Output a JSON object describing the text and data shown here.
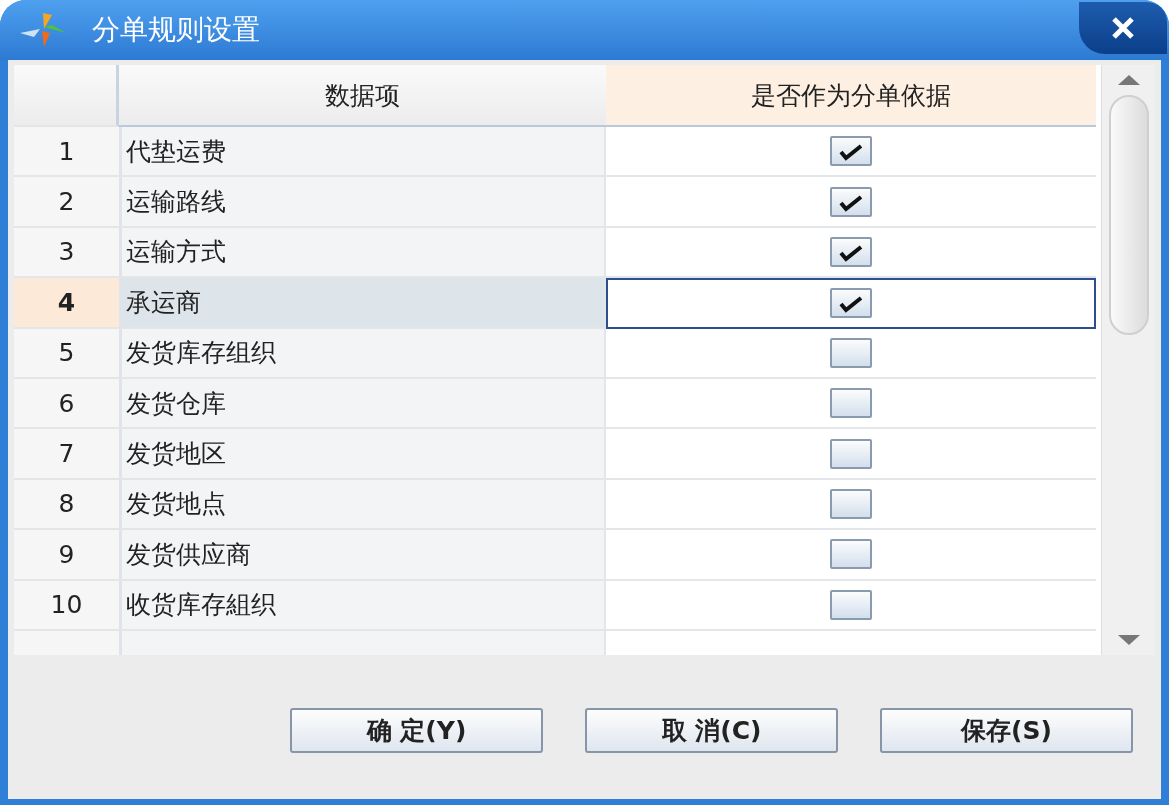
{
  "window": {
    "title": "分单规则设置"
  },
  "table": {
    "columns": [
      "数据项",
      "是否作为分单依据"
    ],
    "rows": [
      {
        "number": "1",
        "item": "代垫运费",
        "checked": true,
        "selected": false
      },
      {
        "number": "2",
        "item": "运输路线",
        "checked": true,
        "selected": false
      },
      {
        "number": "3",
        "item": "运输方式",
        "checked": true,
        "selected": false
      },
      {
        "number": "4",
        "item": "承运商",
        "checked": true,
        "selected": true
      },
      {
        "number": "5",
        "item": "发货库存组织",
        "checked": false,
        "selected": false
      },
      {
        "number": "6",
        "item": "发货仓库",
        "checked": false,
        "selected": false
      },
      {
        "number": "7",
        "item": "发货地区",
        "checked": false,
        "selected": false
      },
      {
        "number": "8",
        "item": "发货地点",
        "checked": false,
        "selected": false
      },
      {
        "number": "9",
        "item": "发货供应商",
        "checked": false,
        "selected": false
      },
      {
        "number": "10",
        "item": "收货库存組织",
        "checked": false,
        "selected": false
      }
    ]
  },
  "buttons": [
    "确 定(Y)",
    "取 消(C)",
    "保存(S)"
  ]
}
